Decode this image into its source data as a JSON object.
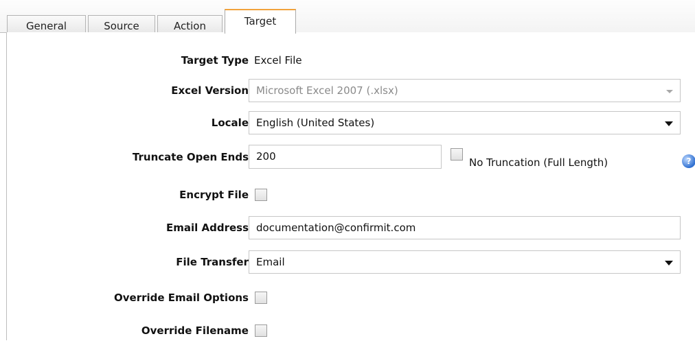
{
  "tabs": [
    {
      "label": "General"
    },
    {
      "label": "Source"
    },
    {
      "label": "Action"
    },
    {
      "label": "Target"
    }
  ],
  "form": {
    "target_type": {
      "label": "Target Type",
      "value": "Excel File"
    },
    "excel_version": {
      "label": "Excel Version",
      "value": "Microsoft Excel 2007 (.xlsx)"
    },
    "locale": {
      "label": "Locale",
      "value": "English (United States)"
    },
    "truncate_open_ends": {
      "label": "Truncate Open Ends",
      "value": "200",
      "no_truncation_label": "No Truncation (Full Length)"
    },
    "encrypt_file": {
      "label": "Encrypt File"
    },
    "email_address": {
      "label": "Email Address",
      "value": "documentation@confirmit.com"
    },
    "file_transfer": {
      "label": "File Transfer",
      "value": "Email"
    },
    "override_email_options": {
      "label": "Override Email Options"
    },
    "override_filename": {
      "label": "Override Filename"
    }
  },
  "icons": {
    "help": "help-icon"
  },
  "colors": {
    "active_tab_accent": "#f2a23a",
    "help_icon": "#2f6fd0"
  }
}
